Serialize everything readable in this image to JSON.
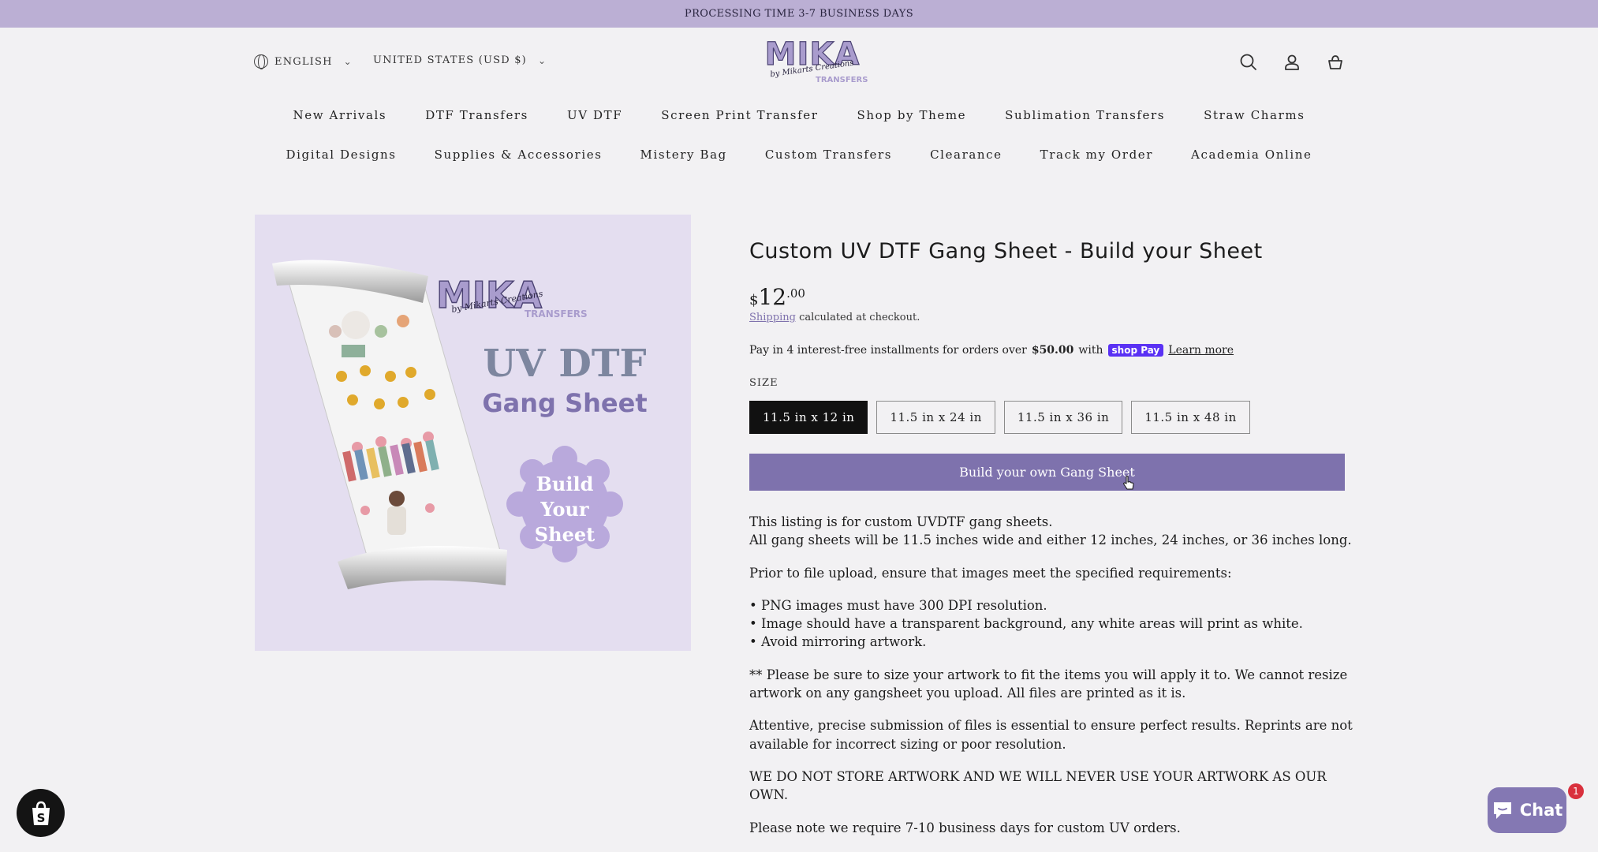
{
  "announcement": "PROCESSING TIME 3-7 BUSINESS DAYS",
  "header": {
    "language": "ENGLISH",
    "country": "UNITED STATES (USD $)",
    "logo": {
      "main": "MIKA",
      "script": "by Mikarts Creations",
      "sub": "TRANSFERS"
    },
    "icons": [
      "search-icon",
      "account-icon",
      "cart-icon"
    ]
  },
  "nav": {
    "row1": [
      "New Arrivals",
      "DTF Transfers",
      "UV DTF",
      "Screen Print Transfer",
      "Shop by Theme",
      "Sublimation Transfers",
      "Straw Charms"
    ],
    "row2": [
      "Digital Designs",
      "Supplies & Accessories",
      "Mistery Bag",
      "Custom Transfers",
      "Clearance",
      "Track my Order",
      "Academia Online"
    ]
  },
  "product_image": {
    "logo_main": "MIKA",
    "logo_script": "by Mikarts Creations",
    "logo_sub": "TRANSFERS",
    "line1": "UV DTF",
    "line2": "Gang Sheet",
    "badge": [
      "Build",
      "Your",
      "Sheet"
    ]
  },
  "product": {
    "title": "Custom UV DTF Gang Sheet - Build your Sheet",
    "price_currency": "$",
    "price_whole": "12",
    "price_cents": ".00",
    "shipping_link": "Shipping",
    "shipping_text": " calculated at checkout.",
    "installments_pre": "Pay in 4 interest-free installments for orders over",
    "installments_amount": "$50.00",
    "installments_with": "with",
    "shop_pay": "shop Pay",
    "learn_more": "Learn more",
    "size_label": "SIZE",
    "sizes": [
      "11.5 in x 12 in",
      "11.5 in x 24 in",
      "11.5 in x 36 in",
      "11.5 in x 48 in"
    ],
    "selected_size": "11.5 in x 12 in",
    "cta": "Build your own Gang Sheet"
  },
  "description": {
    "p1_line1": "This listing is for custom UVDTF gang sheets.",
    "p1_line2": "All gang sheets will be 11.5 inches wide and either 12 inches, 24 inches, or 36 inches long.",
    "p2": "Prior to file upload, ensure that images meet the specified requirements:",
    "bullets": [
      "• PNG images must have 300 DPI resolution.",
      "• Image should have a transparent background, any white areas will print as white.",
      "• Avoid mirroring artwork."
    ],
    "p3": "** Please be sure to size your artwork to fit the items you will apply it to. We cannot resize artwork on any gangsheet you upload. All files are printed as it is.",
    "p4": "Attentive, precise submission of files is essential to ensure perfect results. Reprints are not available for incorrect sizing or poor resolution.",
    "p5": "WE DO NOT STORE ARTWORK AND WE WILL NEVER USE YOUR ARTWORK AS OUR OWN.",
    "p6": "Please note we require 7-10 business days for custom UV orders."
  },
  "chat": {
    "label": "Chat",
    "badge": "1"
  },
  "colors": {
    "accent": "#7e72ad",
    "announcement_bg": "#bbafd4",
    "page_bg": "#f2f1f3"
  }
}
